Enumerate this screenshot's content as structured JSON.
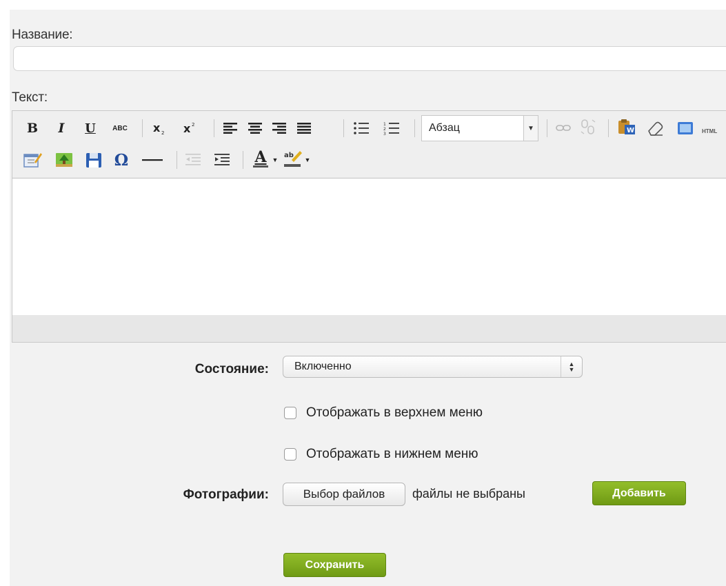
{
  "form": {
    "title_label": "Название:",
    "title_value": "",
    "text_label": "Текст:",
    "state_label": "Состояние:",
    "state_value": "Включенно",
    "show_top_menu_label": "Отображать в верхнем меню",
    "show_bottom_menu_label": "Отображать в нижнем меню",
    "photos_label": "Фотографии:",
    "choose_files_label": "Выбор файлов",
    "no_files_label": "файлы не выбраны",
    "add_label": "Добавить",
    "save_label": "Сохранить"
  },
  "toolbar": {
    "bold": "B",
    "italic": "I",
    "underline": "U",
    "strikethrough": "ABC",
    "format_value": "Абзац",
    "html_label": "HTML",
    "omega": "Ω",
    "font_color": "A",
    "icons": [
      "bold-icon",
      "italic-icon",
      "underline-icon",
      "strikethrough-icon",
      "subscript-icon",
      "superscript-icon",
      "align-left-icon",
      "align-center-icon",
      "align-right-icon",
      "align-justify-icon",
      "bullet-list-icon",
      "numbered-list-icon",
      "link-icon",
      "unlink-icon",
      "paste-word-icon",
      "eraser-icon",
      "media-icon",
      "html-icon",
      "edit-icon",
      "image-icon",
      "save-icon",
      "special-char-icon",
      "horizontal-rule-icon",
      "outdent-icon",
      "indent-icon",
      "font-color-icon",
      "highlight-icon"
    ]
  },
  "colors": {
    "accent_green": "#7ca61c",
    "panel_bg": "#f2f2f2"
  }
}
